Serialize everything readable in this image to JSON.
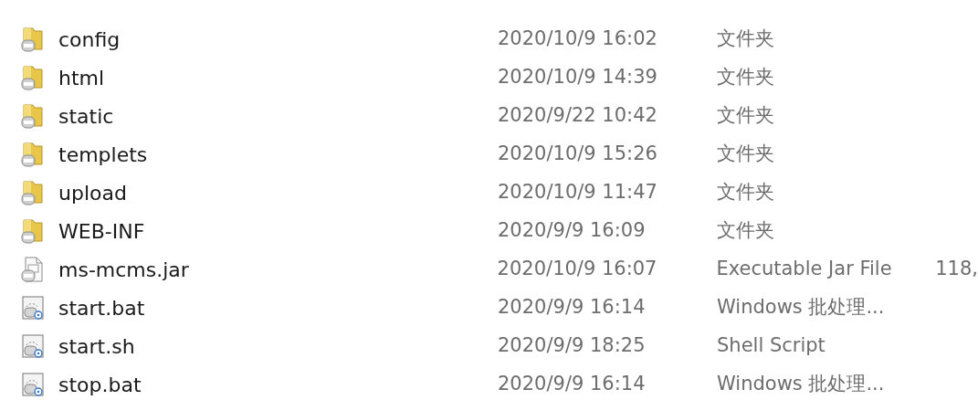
{
  "files": [
    {
      "name": "config",
      "kind": "folder",
      "modified": "2020/10/9 16:02",
      "type": "文件夹"
    },
    {
      "name": "html",
      "kind": "folder",
      "modified": "2020/10/9 14:39",
      "type": "文件夹"
    },
    {
      "name": "static",
      "kind": "folder",
      "modified": "2020/9/22 10:42",
      "type": "文件夹"
    },
    {
      "name": "templets",
      "kind": "folder",
      "modified": "2020/10/9 15:26",
      "type": "文件夹"
    },
    {
      "name": "upload",
      "kind": "folder",
      "modified": "2020/10/9 11:47",
      "type": "文件夹"
    },
    {
      "name": "WEB-INF",
      "kind": "folder",
      "modified": "2020/9/9 16:09",
      "type": "文件夹"
    },
    {
      "name": "ms-mcms.jar",
      "kind": "jar",
      "modified": "2020/10/9 16:07",
      "type": "Executable Jar File",
      "size": "118,"
    },
    {
      "name": "start.bat",
      "kind": "script",
      "modified": "2020/9/9 16:14",
      "type": "Windows 批处理..."
    },
    {
      "name": "start.sh",
      "kind": "script",
      "modified": "2020/9/9 18:25",
      "type": "Shell Script"
    },
    {
      "name": "stop.bat",
      "kind": "script",
      "modified": "2020/9/9 16:14",
      "type": "Windows 批处理..."
    }
  ]
}
